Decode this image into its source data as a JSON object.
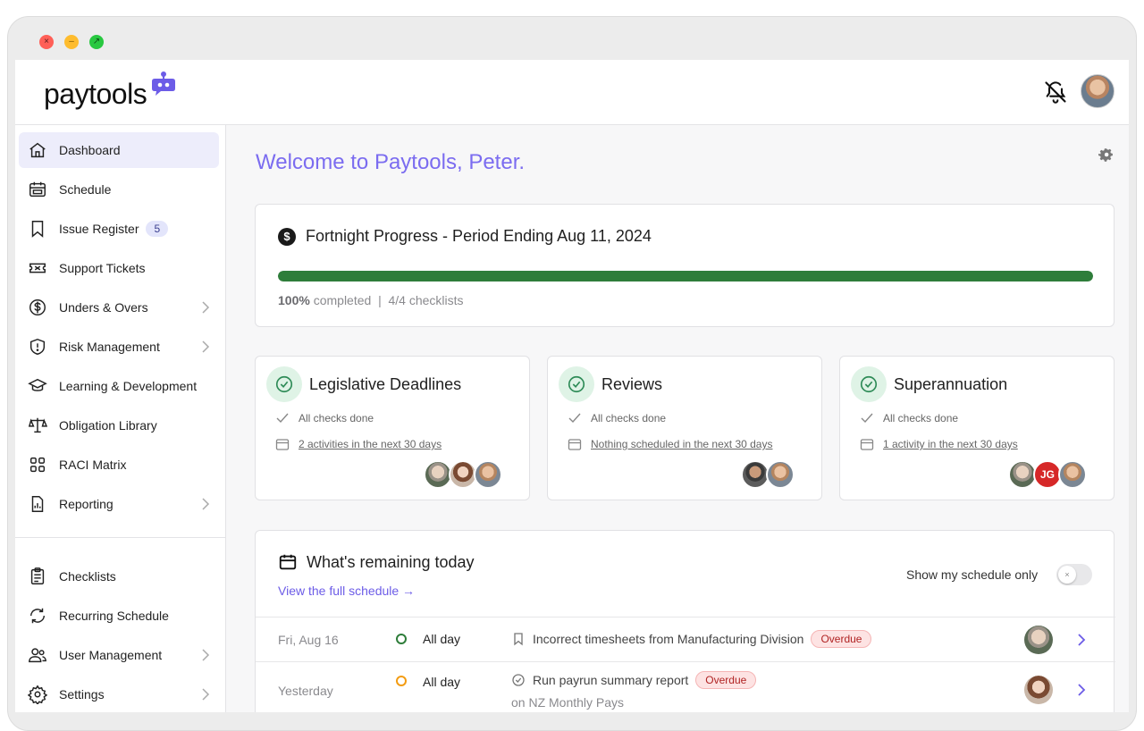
{
  "app": {
    "logo_text": "paytools"
  },
  "sidebar": {
    "items": [
      {
        "label": "Dashboard",
        "icon": "home-icon",
        "active": true
      },
      {
        "label": "Schedule",
        "icon": "calendar-icon"
      },
      {
        "label": "Issue Register",
        "icon": "bookmark-icon",
        "badge": "5"
      },
      {
        "label": "Support Tickets",
        "icon": "ticket-icon"
      },
      {
        "label": "Unders & Overs",
        "icon": "dollar-circle-icon",
        "chevron": true
      },
      {
        "label": "Risk Management",
        "icon": "shield-alert-icon",
        "chevron": true
      },
      {
        "label": "Learning & Development",
        "icon": "graduation-cap-icon"
      },
      {
        "label": "Obligation Library",
        "icon": "scales-icon"
      },
      {
        "label": "RACI Matrix",
        "icon": "grid-icon"
      },
      {
        "label": "Reporting",
        "icon": "report-icon",
        "chevron": true
      },
      {
        "label": "Checklists",
        "icon": "clipboard-icon"
      },
      {
        "label": "Recurring Schedule",
        "icon": "recurring-icon"
      },
      {
        "label": "User Management",
        "icon": "users-icon",
        "chevron": true
      },
      {
        "label": "Settings",
        "icon": "gear-icon",
        "chevron": true
      }
    ]
  },
  "main": {
    "welcome": "Welcome to Paytools, Peter.",
    "progress": {
      "title": "Fortnight Progress - Period Ending Aug 11, 2024",
      "percent": 100,
      "percent_label": "100%",
      "completed_label": "completed",
      "separator": "|",
      "checklists": "4/4 checklists",
      "bar_color": "#2e7d3a"
    },
    "summary_cards": [
      {
        "title": "Legislative Deadlines",
        "status": "All checks done",
        "activity": "2 activities in the next 30 days"
      },
      {
        "title": "Reviews",
        "status": "All checks done",
        "activity": "Nothing scheduled in the next 30 days"
      },
      {
        "title": "Superannuation",
        "status": "All checks done",
        "activity": "1 activity in the next 30 days",
        "initials": "JG"
      }
    ],
    "remaining": {
      "title": "What's remaining today",
      "link": "View the full schedule →",
      "toggle_label": "Show my schedule only",
      "toggle_knob": "×",
      "rows": [
        {
          "date": "Fri, Aug 16",
          "time": "All day",
          "task": "Incorrect timesheets from Manufacturing Division",
          "badge": "Overdue",
          "dot_color": "#2e7d3a"
        },
        {
          "date": "Yesterday",
          "time": "All day",
          "task": "Run payrun summary report",
          "badge": "Overdue",
          "sub": "on NZ Monthly Pays",
          "dot_color": "#f39c12"
        }
      ]
    }
  },
  "colors": {
    "accent": "#7b6cf0",
    "success": "#2e7d3a",
    "danger": "#b02323"
  }
}
